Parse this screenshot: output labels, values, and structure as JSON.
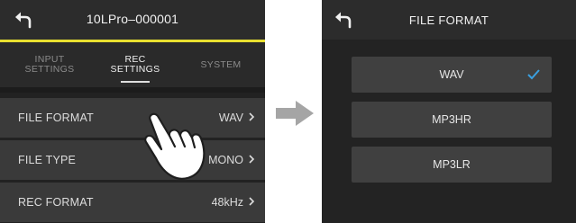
{
  "left_screen": {
    "title": "10LPro–000001",
    "tabs": [
      {
        "line1": "INPUT",
        "line2": "SETTINGS",
        "active": false
      },
      {
        "line1": "REC",
        "line2": "SETTINGS",
        "active": true
      },
      {
        "line1": "SYSTEM",
        "line2": "",
        "active": false
      }
    ],
    "rows": [
      {
        "label": "FILE FORMAT",
        "value": "WAV"
      },
      {
        "label": "FILE TYPE",
        "value": "MONO"
      },
      {
        "label": "REC FORMAT",
        "value": "48kHz"
      }
    ],
    "icons": {
      "back": "back-arrow-icon",
      "chevron": "chevron-right-icon",
      "gesture": "tap-hand-icon"
    }
  },
  "transition_arrow": {
    "icon": "right-arrow-icon",
    "color": "#a5a5a5"
  },
  "right_screen": {
    "title": "FILE FORMAT",
    "options": [
      {
        "label": "WAV",
        "selected": true
      },
      {
        "label": "MP3HR",
        "selected": false
      },
      {
        "label": "MP3LR",
        "selected": false
      }
    ],
    "icons": {
      "back": "back-arrow-icon",
      "check": "checkmark-icon"
    }
  },
  "colors": {
    "accent_line": "#e8e030",
    "checkmark": "#3aa0e0"
  }
}
